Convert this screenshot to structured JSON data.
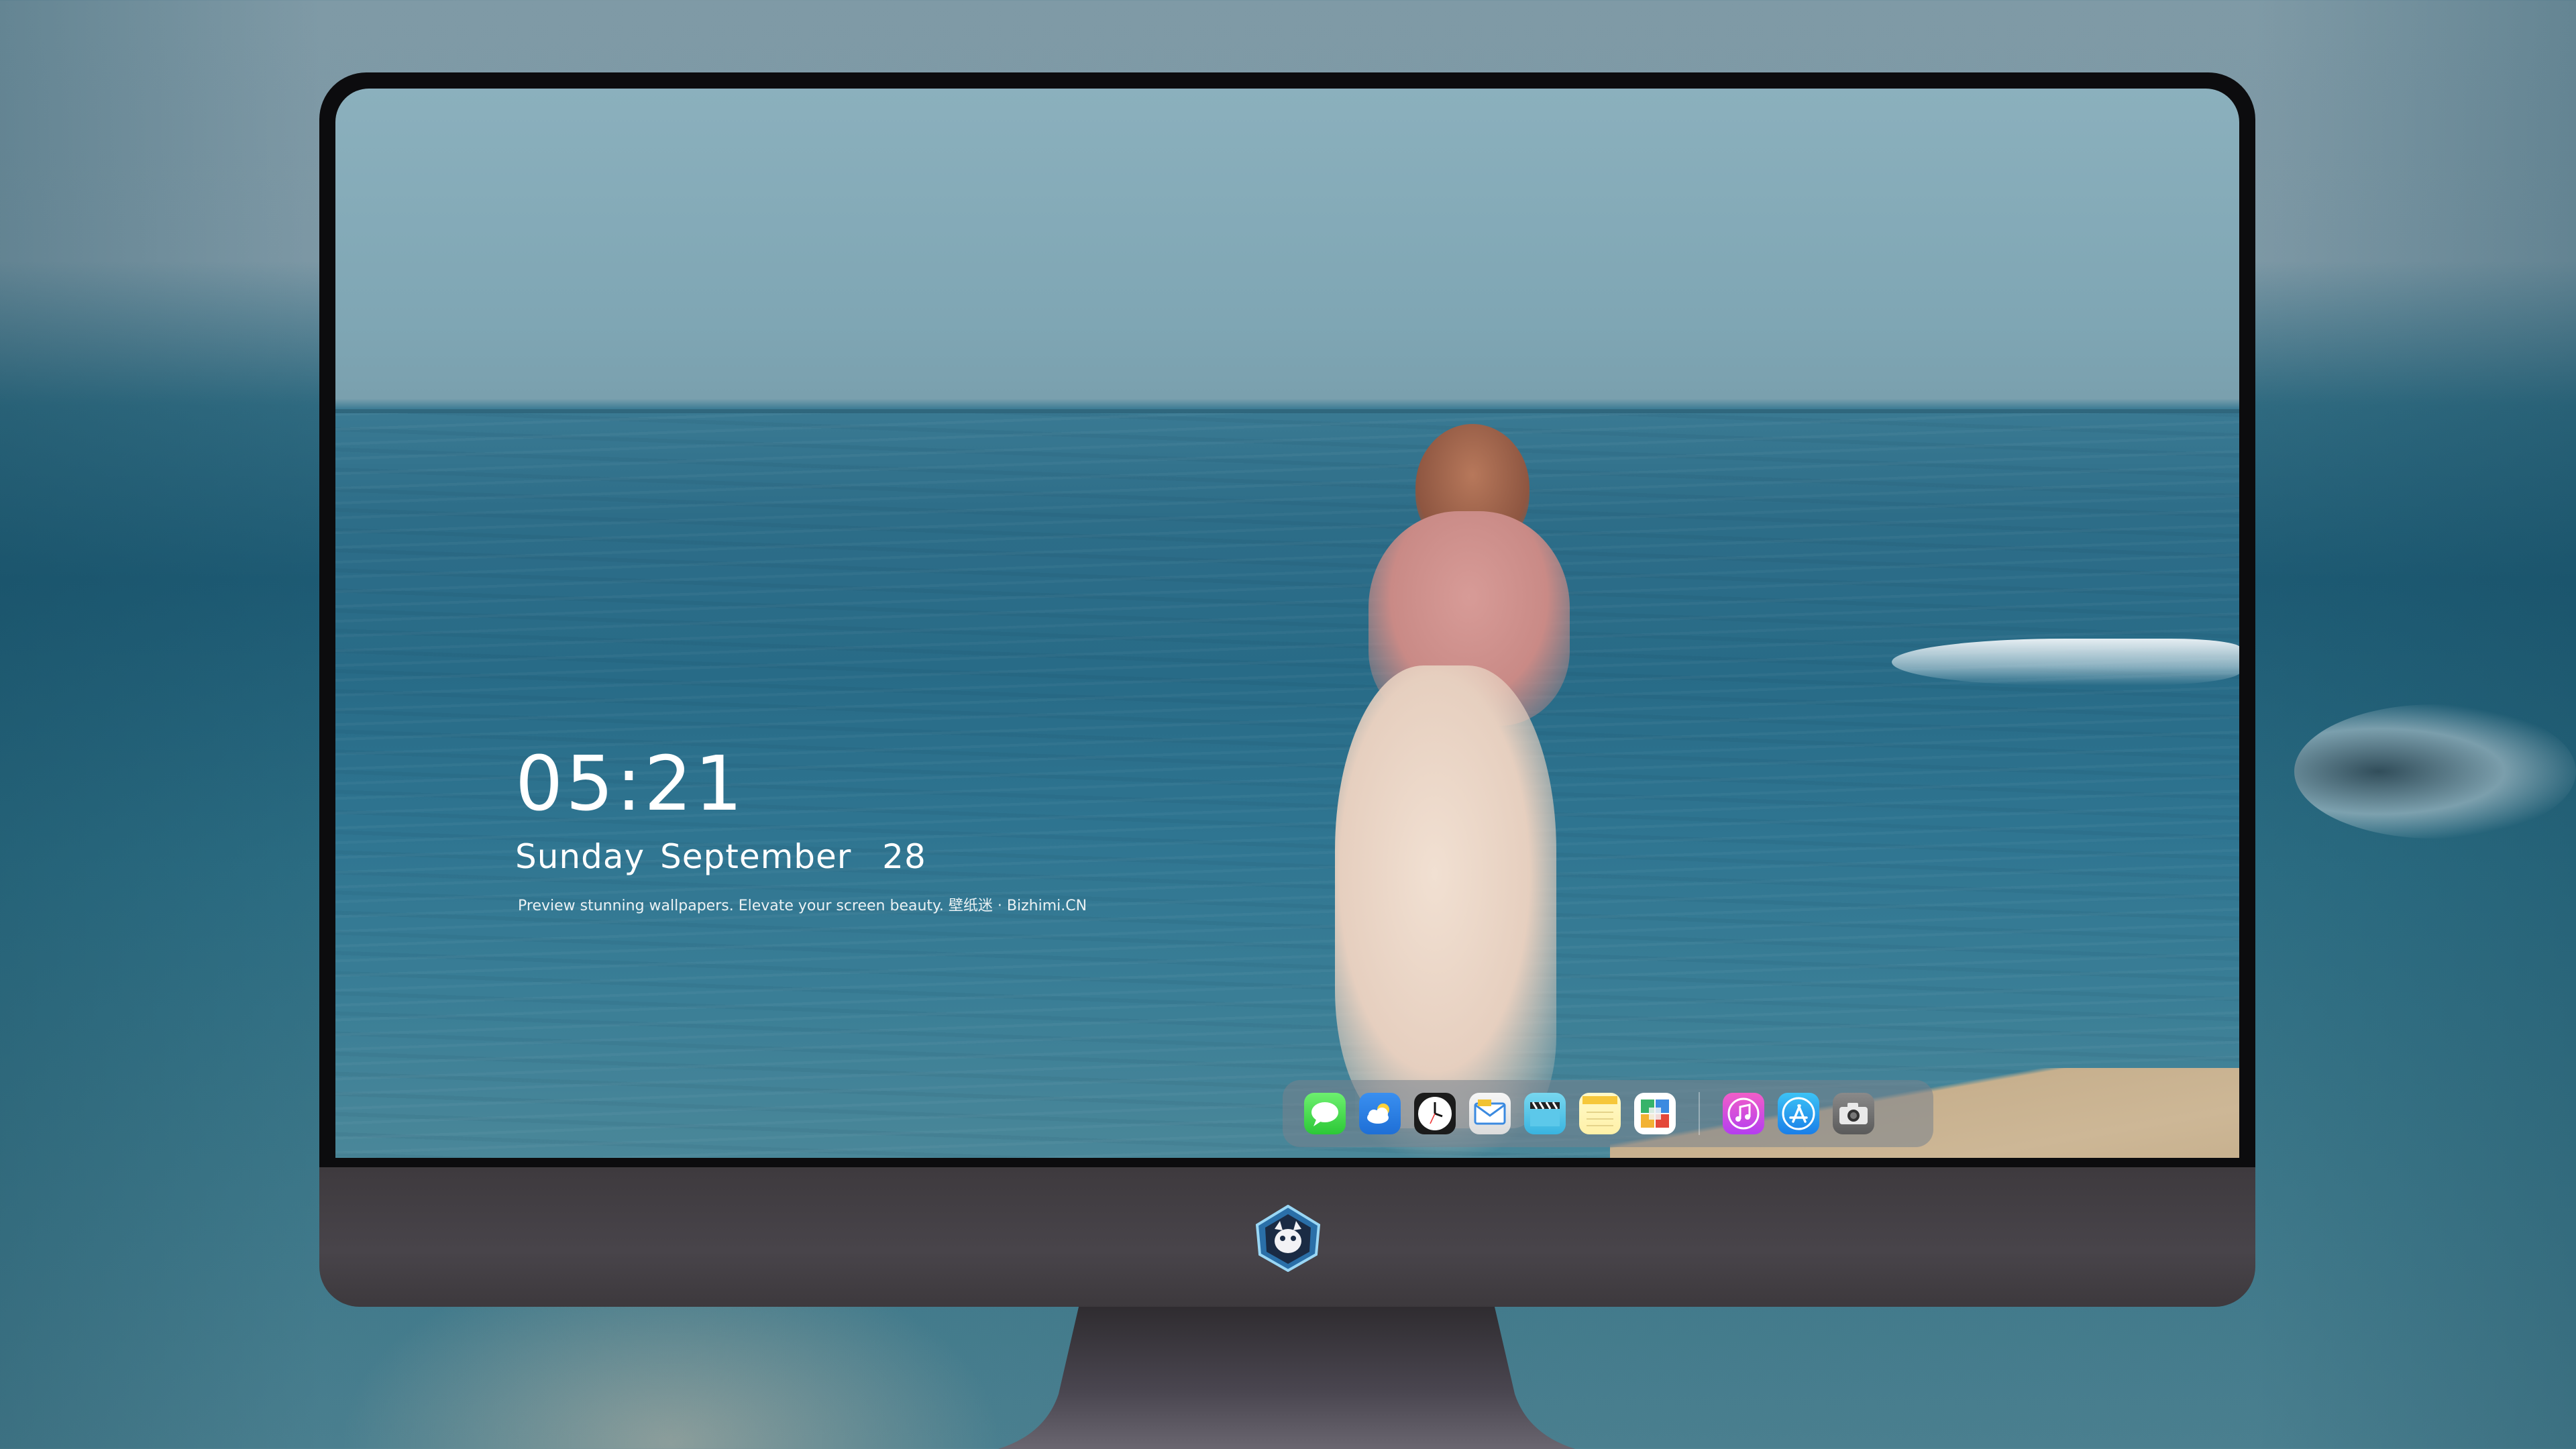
{
  "lockscreen": {
    "time": "05:21",
    "date": "Sunday September  28",
    "tagline": "Preview stunning wallpapers. Elevate your screen beauty. 壁纸迷 · Bizhimi.CN"
  },
  "dock": {
    "apps": [
      {
        "name": "messages-icon"
      },
      {
        "name": "weather-icon"
      },
      {
        "name": "clock-icon"
      },
      {
        "name": "mail-icon"
      },
      {
        "name": "video-icon"
      },
      {
        "name": "notes-icon"
      },
      {
        "name": "photos-icon"
      },
      {
        "name": "music-icon"
      },
      {
        "name": "app-store-icon"
      },
      {
        "name": "camera-icon"
      }
    ]
  },
  "colors": {
    "bezel": "#0c0c0e",
    "chin": "#45414a",
    "sea": "#2d6d88",
    "sky": "#8bb0bd"
  }
}
